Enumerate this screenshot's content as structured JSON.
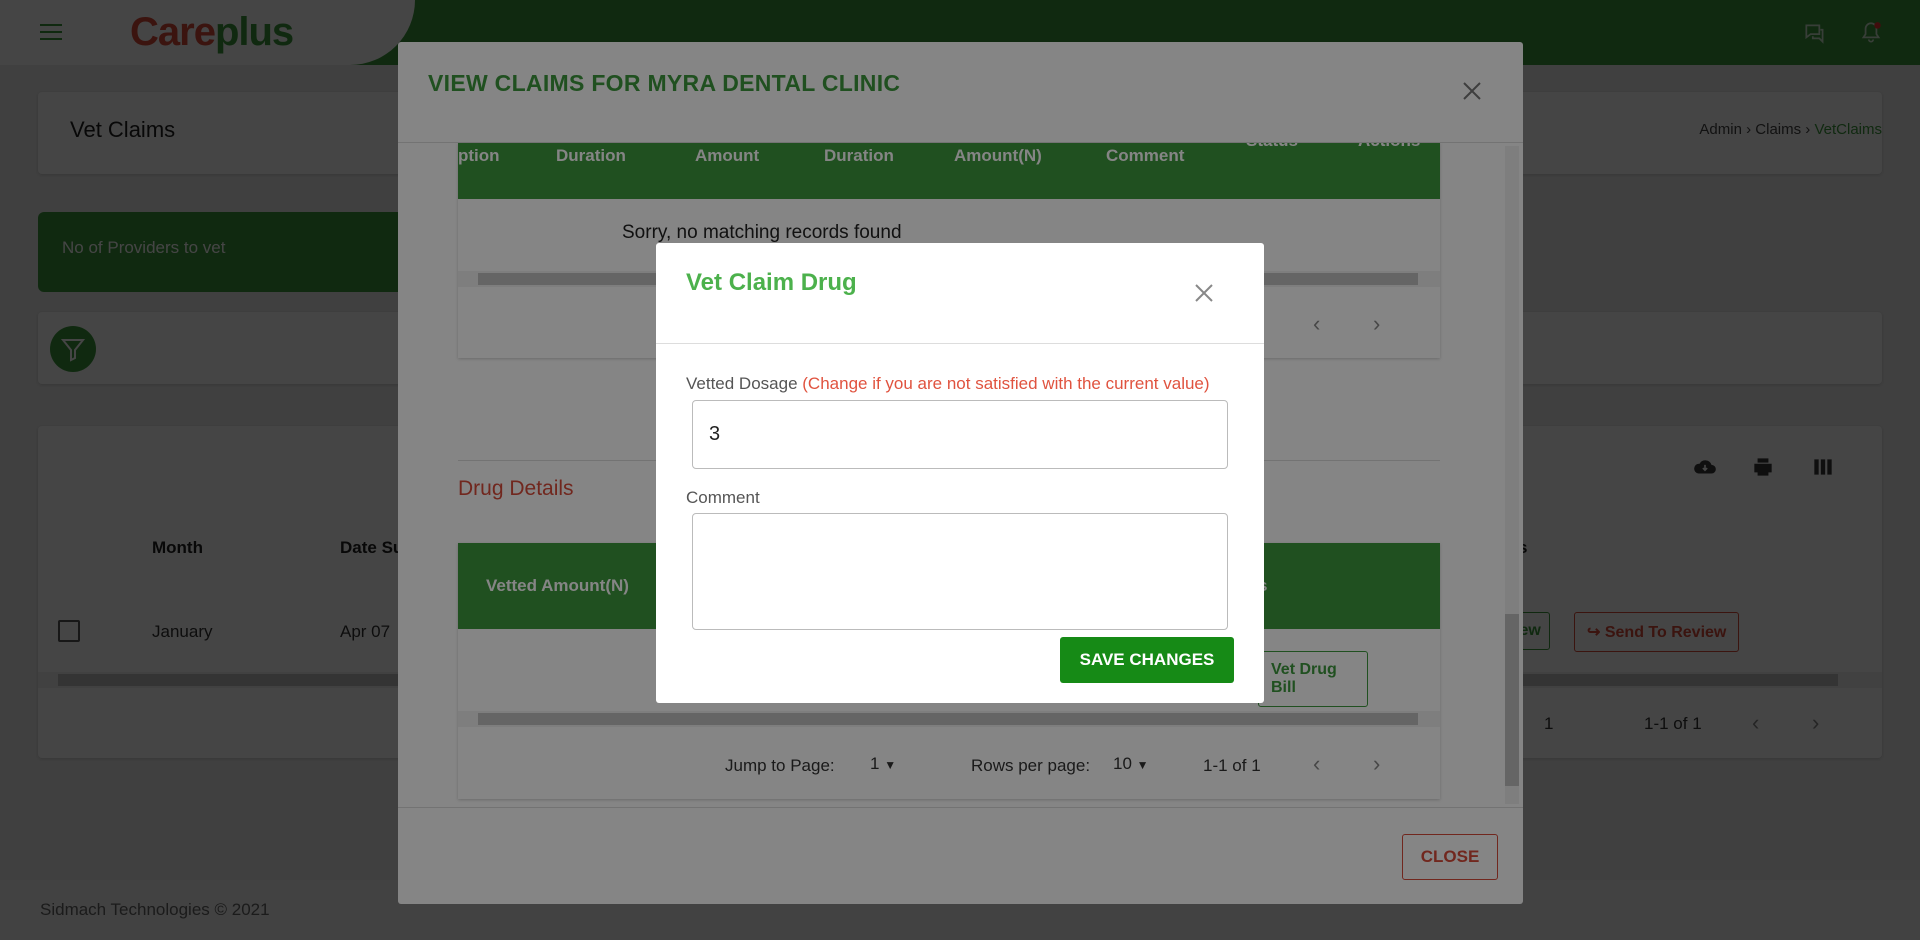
{
  "app": {
    "logo_part1": "Care",
    "logo_part2": "plus"
  },
  "page": {
    "title": "Vet Claims",
    "breadcrumb": [
      "Admin",
      "Claims",
      "VetClaims"
    ],
    "providers_label": "No of Providers to vet",
    "table": {
      "headers": [
        "Month",
        "Date Su",
        "s"
      ],
      "row": {
        "month": "January",
        "date": "Apr 07"
      },
      "row_actions": [
        "iew",
        "Send To Review"
      ],
      "pager": {
        "page": "1",
        "range": "1-1 of 1"
      }
    },
    "footer": "Sidmach Technologies © 2021"
  },
  "claims_modal": {
    "title": "VIEW CLAIMS FOR MYRA DENTAL CLINIC",
    "top_table": {
      "headers": [
        "ption",
        "Duration",
        "Amount",
        "Duration",
        "Amount(N)",
        "Comment",
        "Status",
        "Actions"
      ],
      "empty_message": "Sorry, no matching records found"
    },
    "drug_section_title": "Drug Details",
    "drug_table": {
      "headers": [
        "Vetted Amount(N)",
        "s"
      ],
      "row_action": "Vet Drug Bill",
      "pager": {
        "jump_label": "Jump to Page:",
        "jump_value": "1",
        "rows_label": "Rows per page:",
        "rows_value": "10",
        "range": "1-1 of 1"
      }
    },
    "close_label": "CLOSE"
  },
  "vet_modal": {
    "title": "Vet Claim Drug",
    "dosage_label": "Vetted Dosage",
    "dosage_hint": "(Change if you are not satisfied with the current value)",
    "dosage_value": "3",
    "comment_label": "Comment",
    "comment_value": "",
    "save_label": "SAVE CHANGES"
  },
  "colors": {
    "brand_green": "#3f9a3f",
    "accent_red": "#d84b3a",
    "save_green": "#168a16"
  }
}
